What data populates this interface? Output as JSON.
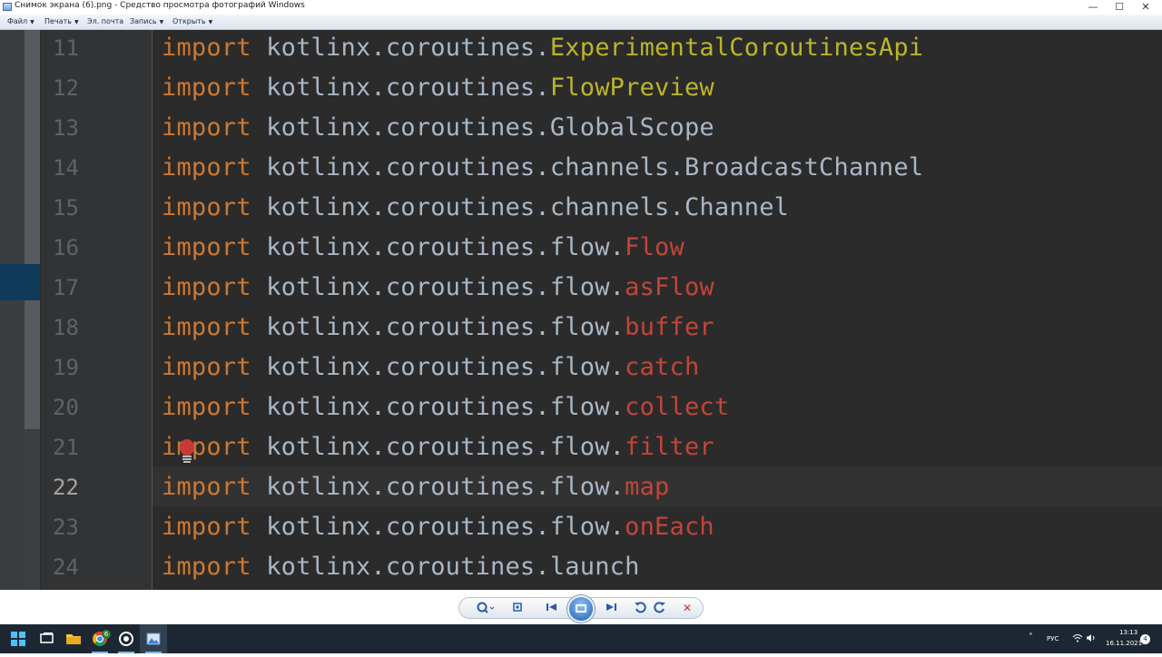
{
  "window": {
    "title": "Снимок экрана (6).png - Средство просмотра фотографий Windows",
    "controls": {
      "minimize": "—",
      "maximize": "☐",
      "close": "✕"
    }
  },
  "menu": [
    {
      "label": "Файл",
      "has_dropdown": true
    },
    {
      "label": "Печать",
      "has_dropdown": true
    },
    {
      "label": "Эл. почта",
      "has_dropdown": false
    },
    {
      "label": "Запись",
      "has_dropdown": true
    },
    {
      "label": "Открыть",
      "has_dropdown": true
    }
  ],
  "editor": {
    "current_line": "22",
    "lines": [
      {
        "num": "11",
        "kw": "import",
        "pkg": " kotlinx.coroutines.",
        "name": "ExperimentalCoroutinesApi",
        "kind": "annotation"
      },
      {
        "num": "12",
        "kw": "import",
        "pkg": " kotlinx.coroutines.",
        "name": "FlowPreview",
        "kind": "annotation"
      },
      {
        "num": "13",
        "kw": "import",
        "pkg": " kotlinx.coroutines.",
        "name": "GlobalScope",
        "kind": "class"
      },
      {
        "num": "14",
        "kw": "import",
        "pkg": " kotlinx.coroutines.channels.",
        "name": "BroadcastChannel",
        "kind": "class"
      },
      {
        "num": "15",
        "kw": "import",
        "pkg": " kotlinx.coroutines.channels.",
        "name": "Channel",
        "kind": "class"
      },
      {
        "num": "16",
        "kw": "import",
        "pkg": " kotlinx.coroutines.flow.",
        "name": "Flow",
        "kind": "unresolved"
      },
      {
        "num": "17",
        "kw": "import",
        "pkg": " kotlinx.coroutines.flow.",
        "name": "asFlow",
        "kind": "unresolved"
      },
      {
        "num": "18",
        "kw": "import",
        "pkg": " kotlinx.coroutines.flow.",
        "name": "buffer",
        "kind": "unresolved"
      },
      {
        "num": "19",
        "kw": "import",
        "pkg": " kotlinx.coroutines.flow.",
        "name": "catch",
        "kind": "unresolved"
      },
      {
        "num": "20",
        "kw": "import",
        "pkg": " kotlinx.coroutines.flow.",
        "name": "collect",
        "kind": "unresolved"
      },
      {
        "num": "21",
        "kw": "import",
        "pkg": " kotlinx.coroutines.flow.",
        "name": "filter",
        "kind": "unresolved"
      },
      {
        "num": "22",
        "kw": "import",
        "pkg": " kotlinx.coroutines.flow.",
        "name": "map",
        "kind": "unresolved"
      },
      {
        "num": "23",
        "kw": "import",
        "pkg": " kotlinx.coroutines.flow.",
        "name": "onEach",
        "kind": "unresolved"
      },
      {
        "num": "24",
        "kw": "import",
        "pkg": " kotlinx.coroutines.",
        "name": "launch",
        "kind": "class"
      }
    ]
  },
  "colors": {
    "keyword": "#cc7832",
    "annotation": "#bbb529",
    "class": "#a9b7c6",
    "unresolved": "#c2453a",
    "background": "#2b2b2b"
  },
  "viewer_toolbar": {
    "buttons": [
      "zoom-icon",
      "actual-size-icon",
      "previous-icon",
      "slideshow-icon",
      "next-icon",
      "rotate-left-icon",
      "rotate-right-icon",
      "delete-icon"
    ]
  },
  "taskbar": {
    "apps": [
      "task-view-icon",
      "file-explorer-icon",
      "chrome-icon",
      "whatsapp-icon",
      "photo-viewer-icon"
    ],
    "chrome_badge": "6",
    "tray": {
      "language": "РУС",
      "time": "13:13",
      "date": "16.11.2021",
      "notifications": "4"
    }
  }
}
